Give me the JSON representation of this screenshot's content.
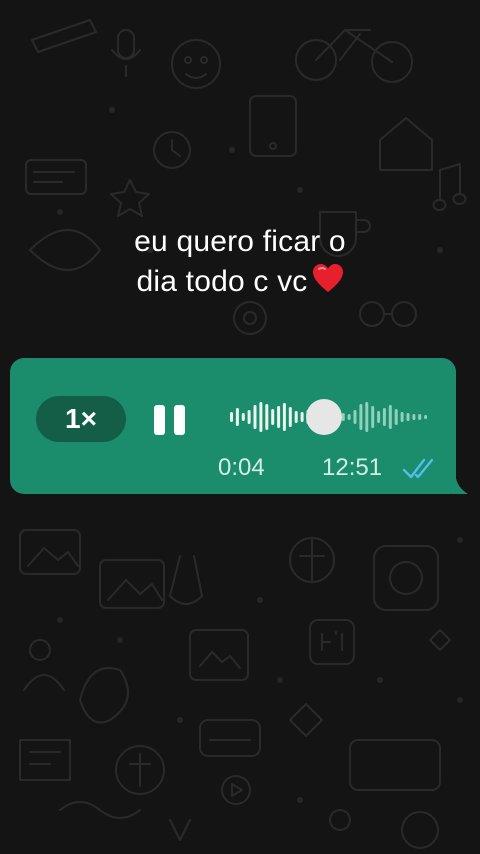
{
  "caption": {
    "line1": "eu quero ficar o",
    "line2": "dia todo c vc"
  },
  "icons": {
    "caption_emoji": "red-heart-icon",
    "play_state": "pause-icon",
    "read_receipt": "double-check-icon"
  },
  "voice_message": {
    "speed_label": "1×",
    "duration": "0:04",
    "time": "12:51",
    "progress": 0.5
  },
  "colors": {
    "background": "#141414",
    "bubble": "#1b8c6c",
    "speed_pill": "#145e48",
    "read_receipt": "#53bdeb",
    "heart": "#e8202d"
  }
}
